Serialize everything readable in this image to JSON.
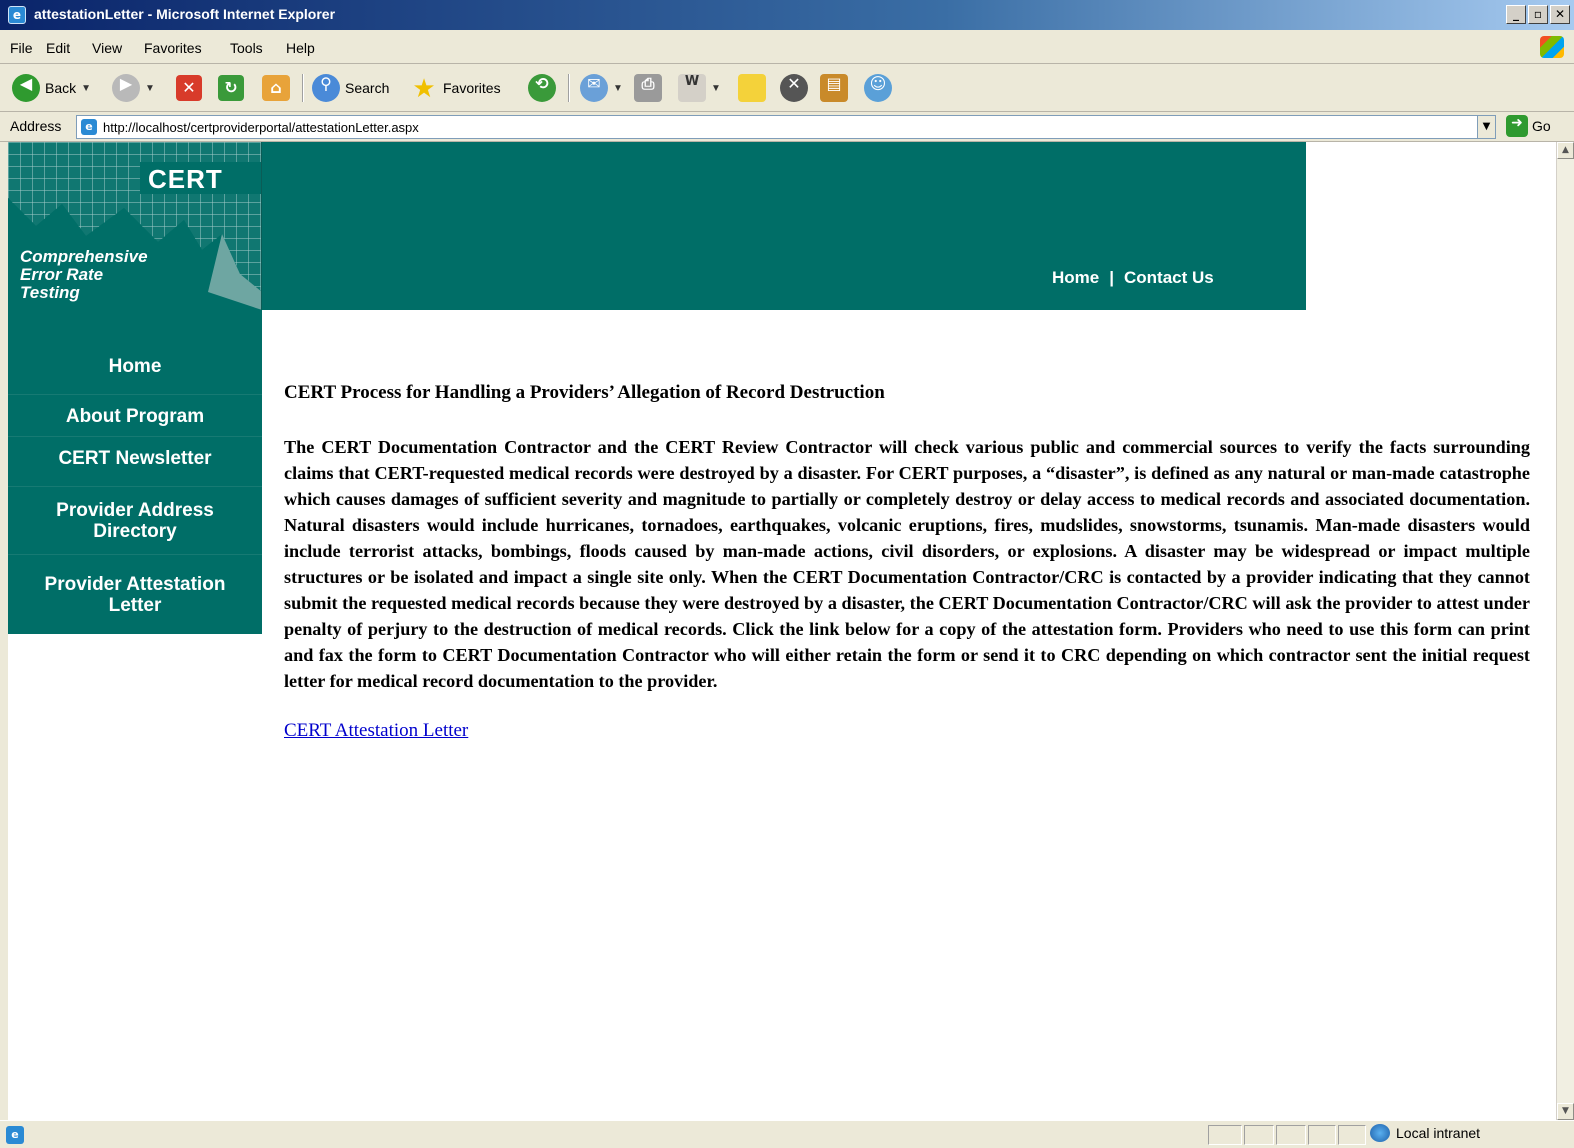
{
  "window": {
    "title": "attestationLetter - Microsoft Internet Explorer",
    "buttons": [
      "_",
      "ł",
      "✕"
    ]
  },
  "menu": [
    "File",
    "Edit",
    "View",
    "Favorites",
    "Tools",
    "Help"
  ],
  "toolbar": {
    "back_label": "Back",
    "search_label": "Search",
    "favorites_label": "Favorites"
  },
  "address": {
    "label": "Address",
    "url": "http://localhost/certproviderportal/attestationLetter.aspx",
    "go_label": "Go"
  },
  "site": {
    "logo_word": "CERT",
    "tagline_1": "Comprehensive",
    "tagline_2": "Error Rate",
    "tagline_3": "Testing",
    "header_nav": {
      "home": "Home",
      "separator": "|",
      "contact": "Contact Us"
    },
    "side_nav": [
      "Home",
      "About Program",
      "CERT Newsletter",
      "Provider Address",
      "Directory",
      "Provider Attestation",
      "Letter"
    ],
    "colors": {
      "teal": "#006e67",
      "link": "#0000cc"
    }
  },
  "content": {
    "heading": "CERT Process for Handling a Providers’ Allegation of Record Destruction",
    "body": "The CERT Documentation Contractor and the CERT Review Contractor will check various public and commercial sources to verify the facts surrounding claims that CERT-requested medical records were destroyed by a disaster. For CERT purposes, a “disaster”, is defined as any natural or man-made catastrophe which causes damages of sufficient severity and magnitude to partially or completely destroy or delay access to medical records and associated documentation. Natural disasters would include hurricanes, tornadoes, earthquakes, volcanic eruptions, fires, mudslides, snowstorms, tsunamis. Man-made disasters would include terrorist attacks, bombings, floods caused by man-made actions, civil disorders, or explosions. A disaster may be widespread or impact multiple structures or be isolated and impact a single site only. When the CERT Documentation Contractor/CRC is contacted by a provider indicating that they cannot submit the requested medical records because they were destroyed by a disaster, the CERT Documentation Contractor/CRC will ask the provider to attest under penalty of perjury to the destruction of medical records. Click the link below for a copy of the attestation form. Providers who need to use this form can print and fax the form to CERT Documentation Contractor who will either retain the form or send it to CRC depending on which contractor sent the initial request letter for medical record documentation to the provider.",
    "link": "CERT Attestation Letter"
  },
  "status": {
    "zone": "Local intranet"
  }
}
